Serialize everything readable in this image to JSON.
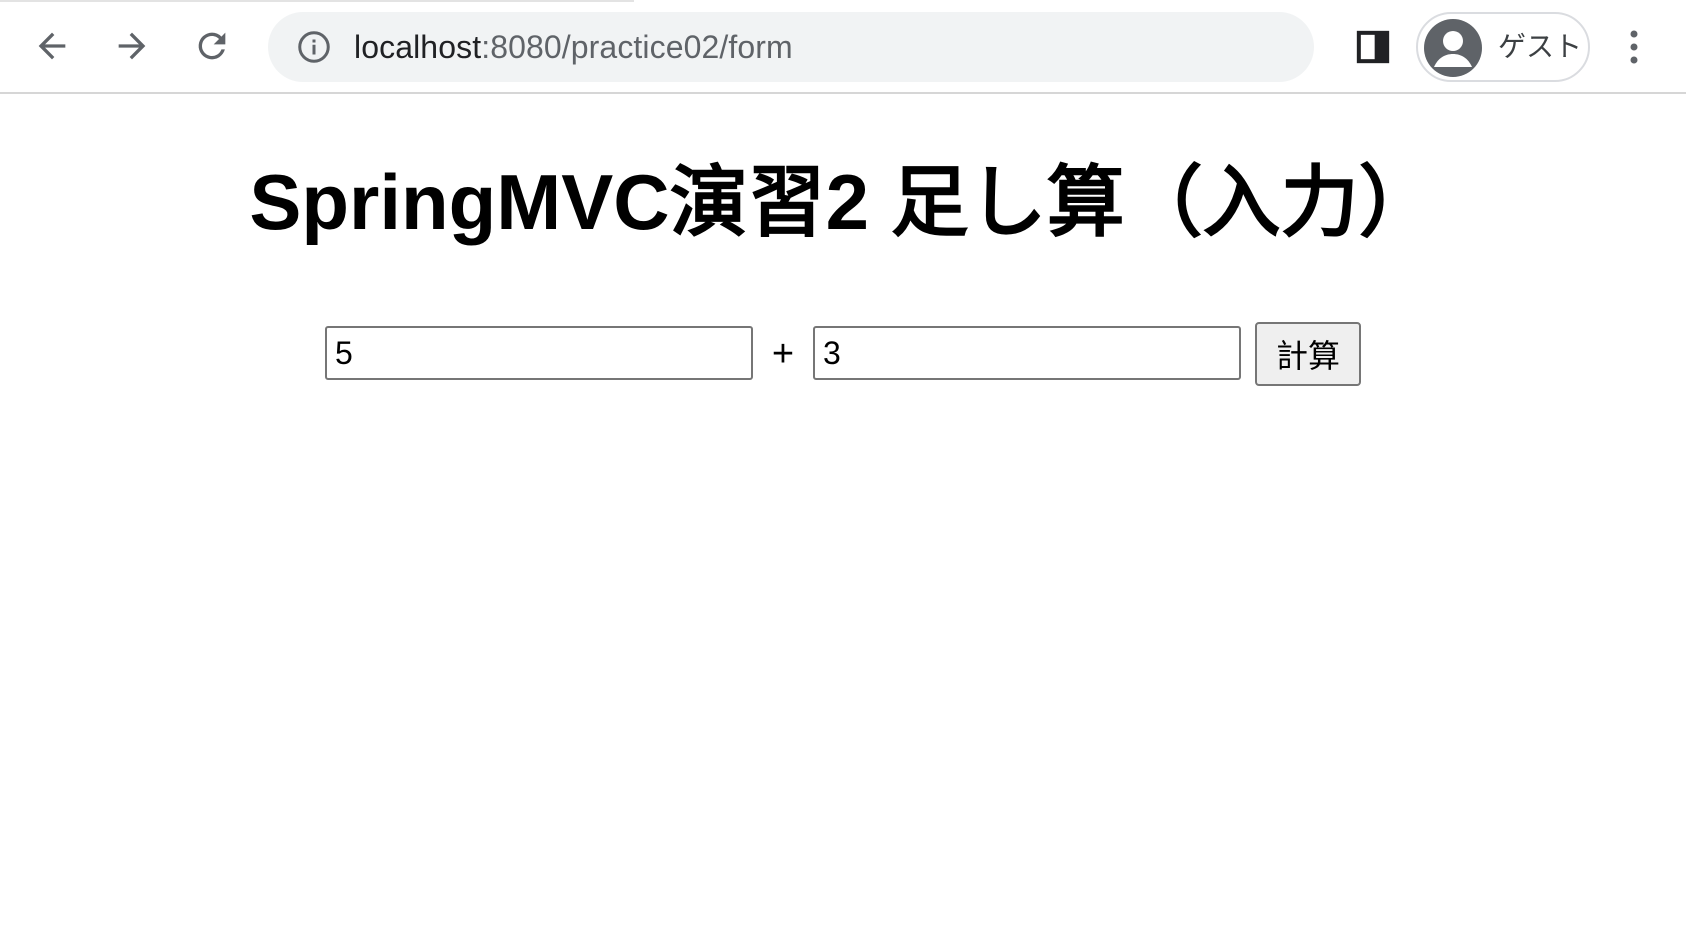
{
  "browser": {
    "url_host": "localhost",
    "url_rest": ":8080/practice02/form",
    "profile_label": "ゲスト",
    "icons": {
      "back": "back-arrow-icon",
      "forward": "forward-arrow-icon",
      "reload": "reload-icon",
      "info": "info-icon",
      "side_panel": "side-panel-icon",
      "avatar": "person-icon",
      "menu": "kebab-menu-icon"
    }
  },
  "page": {
    "title": "SpringMVC演習2 足し算（入力）",
    "form": {
      "first_value": "5",
      "operator": "+",
      "second_value": "3",
      "submit_label": "計算"
    }
  }
}
